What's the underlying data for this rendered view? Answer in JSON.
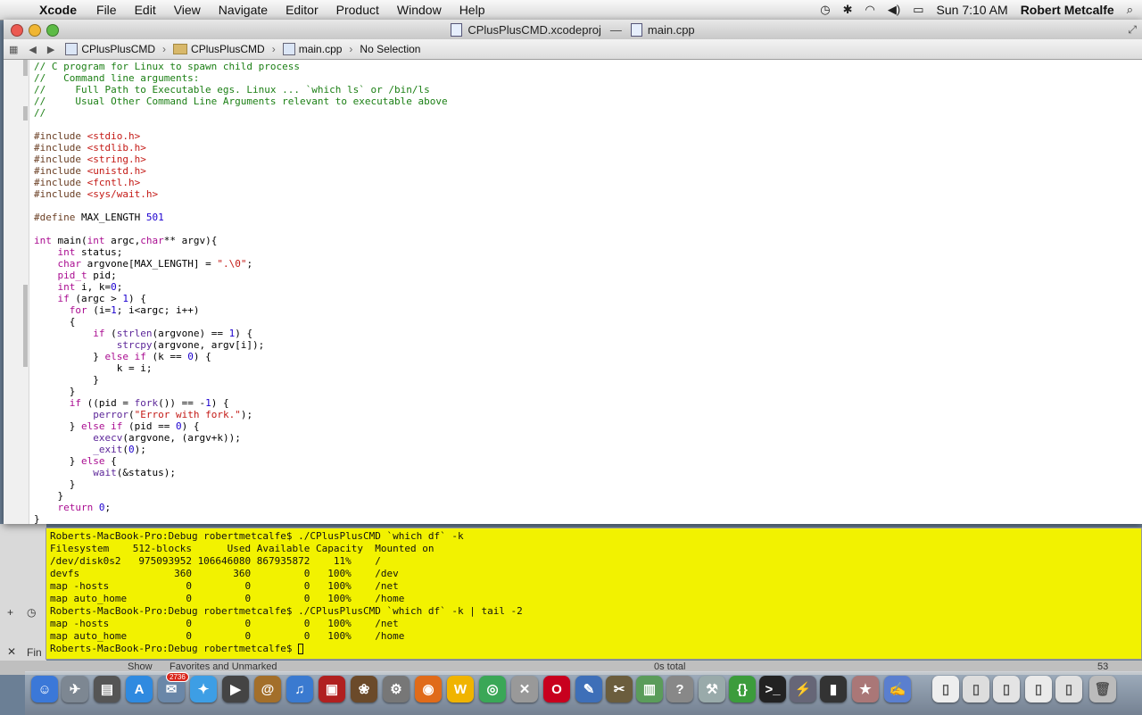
{
  "menubar": {
    "app_name": "Xcode",
    "items": [
      "File",
      "Edit",
      "View",
      "Navigate",
      "Editor",
      "Product",
      "Window",
      "Help"
    ],
    "clock": "Sun 7:10 AM",
    "user": "Robert Metcalfe"
  },
  "window": {
    "title_project": "CPlusPlusCMD.xcodeproj",
    "title_separator": "—",
    "title_file": "main.cpp"
  },
  "jumpbar": {
    "crumbs": [
      "CPlusPlusCMD",
      "CPlusPlusCMD",
      "main.cpp",
      "No Selection"
    ]
  },
  "editor": {
    "lines": [
      "// C program for Linux to spawn child process",
      "//   Command line arguments:",
      "//     Full Path to Executable egs. Linux ... `which ls` or /bin/ls",
      "//     Usual Other Command Line Arguments relevant to executable above",
      "//",
      "",
      "#include <stdio.h>",
      "#include <stdlib.h>",
      "#include <string.h>",
      "#include <unistd.h>",
      "#include <fcntl.h>",
      "#include <sys/wait.h>",
      "",
      "#define MAX_LENGTH 501",
      "",
      "int main(int argc,char** argv){",
      "    int status;",
      "    char argvone[MAX_LENGTH] = \".\\0\";",
      "    pid_t pid;",
      "    int i, k=0;",
      "    if (argc > 1) {",
      "      for (i=1; i<argc; i++)",
      "      {",
      "          if (strlen(argvone) == 1) {",
      "              strcpy(argvone, argv[i]);",
      "          } else if (k == 0) {",
      "              k = i;",
      "          }",
      "      }",
      "      if ((pid = fork()) == -1) {",
      "          perror(\"Error with fork.\");",
      "      } else if (pid == 0) {",
      "          execv(argvone, (argv+k));",
      "          _exit(0);",
      "      } else {",
      "          wait(&status);",
      "      }",
      "    }",
      "    return 0;",
      "}"
    ]
  },
  "terminal": {
    "lines": [
      "Roberts-MacBook-Pro:Debug robertmetcalfe$ ./CPlusPlusCMD `which df` -k",
      "Filesystem    512-blocks      Used Available Capacity  Mounted on",
      "/dev/disk0s2   975093952 106646080 867935872    11%    /",
      "devfs                360       360         0   100%    /dev",
      "map -hosts             0         0         0   100%    /net",
      "map auto_home          0         0         0   100%    /home",
      "Roberts-MacBook-Pro:Debug robertmetcalfe$ ./CPlusPlusCMD `which df` -k | tail -2",
      "map -hosts             0         0         0   100%    /net",
      "map auto_home          0         0         0   100%    /home"
    ],
    "prompt": "Roberts-MacBook-Pro:Debug robertmetcalfe$ "
  },
  "background": {
    "find_label": "Fin",
    "show_label": "Show",
    "show_value": "Favorites and Unmarked",
    "total_label": "0s total",
    "count": "53"
  },
  "dock": {
    "badge": "2736"
  },
  "colors": {
    "terminal_bg": "#f2f200",
    "comment": "#1b7f14",
    "keyword": "#aa0d91",
    "string": "#c41a16",
    "number": "#1c00cf"
  }
}
